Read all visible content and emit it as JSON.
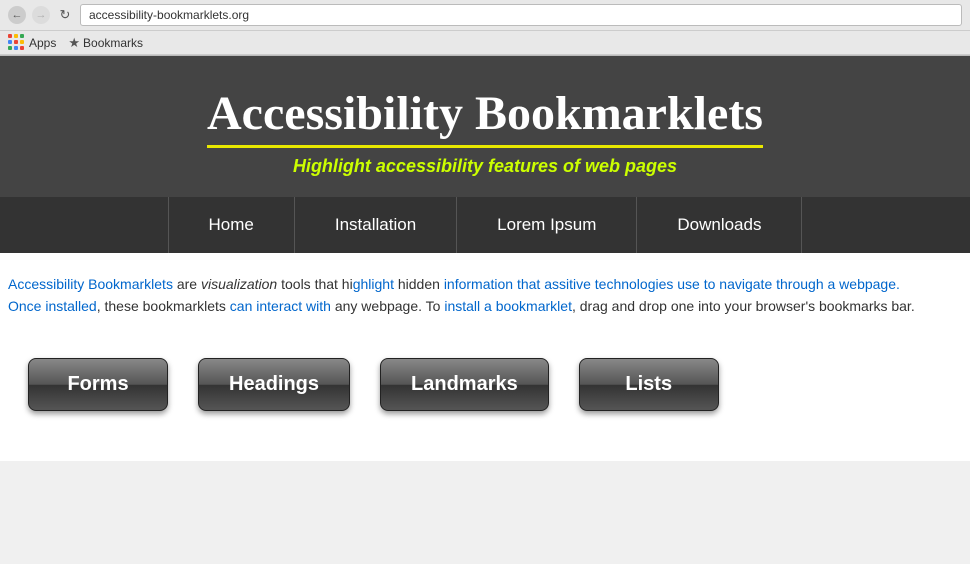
{
  "browser": {
    "url": "accessibility-bookmarklets.org",
    "back_btn": "←",
    "forward_btn": "→",
    "refresh_btn": "↻",
    "apps_label": "Apps",
    "bookmarks_label": "Bookmarks"
  },
  "header": {
    "title": "Accessibility Bookmarklets",
    "subtitle": "Highlight accessibility features of web pages"
  },
  "nav": {
    "items": [
      {
        "label": "Home"
      },
      {
        "label": "Installation"
      },
      {
        "label": "Lorem Ipsum"
      },
      {
        "label": "Downloads"
      }
    ]
  },
  "main": {
    "intro_line1": "Accessibility Bookmarklets are visualization tools that highlight hidden information that assitive technologies use to navigate through a webpage.",
    "intro_line2": "Once installed, these bookmarklets can interact with any webpage. To install a bookmarklet, drag and drop one into your browser's bookmarks bar."
  },
  "bookmarklets": [
    {
      "label": "Forms"
    },
    {
      "label": "Headings"
    },
    {
      "label": "Landmarks"
    },
    {
      "label": "Lists"
    }
  ]
}
